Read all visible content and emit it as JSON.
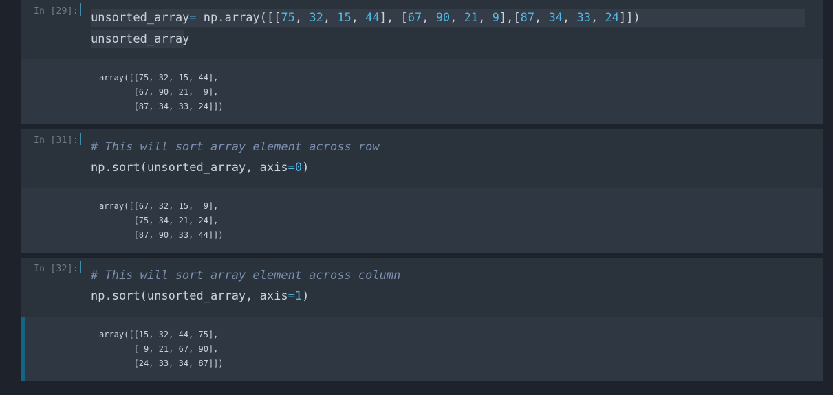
{
  "cells": [
    {
      "prompt": "In [29]:",
      "code": [
        [
          {
            "t": "unsorted_array",
            "c": ""
          },
          {
            "t": "=",
            "c": "op"
          },
          {
            "t": " np.array([[",
            "c": ""
          },
          {
            "t": "75",
            "c": "num"
          },
          {
            "t": ", ",
            "c": ""
          },
          {
            "t": "32",
            "c": "num"
          },
          {
            "t": ", ",
            "c": ""
          },
          {
            "t": "15",
            "c": "num"
          },
          {
            "t": ", ",
            "c": ""
          },
          {
            "t": "44",
            "c": "num"
          },
          {
            "t": "], [",
            "c": ""
          },
          {
            "t": "67",
            "c": "num"
          },
          {
            "t": ", ",
            "c": ""
          },
          {
            "t": "90",
            "c": "num"
          },
          {
            "t": ", ",
            "c": ""
          },
          {
            "t": "21",
            "c": "num"
          },
          {
            "t": ", ",
            "c": ""
          },
          {
            "t": "9",
            "c": "num"
          },
          {
            "t": "],[",
            "c": ""
          },
          {
            "t": "87",
            "c": "num"
          },
          {
            "t": ", ",
            "c": ""
          },
          {
            "t": "34",
            "c": "num"
          },
          {
            "t": ", ",
            "c": ""
          },
          {
            "t": "33",
            "c": "num"
          },
          {
            "t": ", ",
            "c": ""
          },
          {
            "t": "24",
            "c": "num"
          },
          {
            "t": "]])",
            "c": ""
          }
        ],
        [
          {
            "t": "unsorted_array",
            "c": ""
          }
        ]
      ],
      "output": [
        "array([[75, 32, 15, 44],",
        "       [67, 90, 21,  9],",
        "       [87, 34, 33, 24]])"
      ]
    },
    {
      "prompt": "In [31]:",
      "code": [
        [
          {
            "t": "# This will sort array element across row",
            "c": "comment"
          }
        ],
        [
          {
            "t": "np.sort(unsorted_array, axis",
            "c": ""
          },
          {
            "t": "=",
            "c": "op"
          },
          {
            "t": "0",
            "c": "num"
          },
          {
            "t": ")",
            "c": ""
          }
        ]
      ],
      "output": [
        "array([[67, 32, 15,  9],",
        "       [75, 34, 21, 24],",
        "       [87, 90, 33, 44]])"
      ]
    },
    {
      "prompt": "In [32]:",
      "code": [
        [
          {
            "t": "# This will sort array element across column",
            "c": "comment"
          }
        ],
        [
          {
            "t": "np.sort(unsorted_array, axis",
            "c": ""
          },
          {
            "t": "=",
            "c": "op"
          },
          {
            "t": "1",
            "c": "num"
          },
          {
            "t": ")",
            "c": ""
          }
        ]
      ],
      "output": [
        "array([[15, 32, 44, 75],",
        "       [ 9, 21, 67, 90],",
        "       [24, 33, 34, 87]])"
      ]
    }
  ],
  "colors": {
    "background": "#1e232b",
    "cell": "#2a323c",
    "output": "#2f3742",
    "number": "#53b9e8",
    "comment": "#7b8fb0",
    "selection": "#1a8fba"
  }
}
